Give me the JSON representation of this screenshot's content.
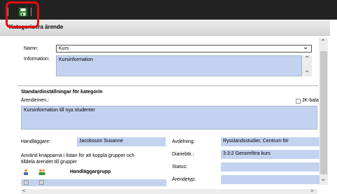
{
  "dialog": {
    "title": "Kategorisera ärende"
  },
  "form": {
    "namn_label": "Namn:",
    "namn_value": "Kurs",
    "information_label": "Information:",
    "information_value": "Kursinformation"
  },
  "standard": {
    "heading": "Standardinställningar för kategorin",
    "arendemening_label": "Ärendemen.:",
    "jk_label": "JK-bala",
    "arendemening_value": "Kursinformation till nya studenter"
  },
  "details": {
    "handlaggare_label": "Handläggare:",
    "handlaggare_value": "Jacobsson Susanne",
    "hint_line1": "Använd knapparna i listan för att koppla grupper och",
    "hint_line2": "tilldela ärendet till grupper",
    "group_column": "Handläggargrupp",
    "avdelning_label": "Avdelning:",
    "avdelning_value": "Rysslandsstudier, Centrum för",
    "diariebeteckning_label": "Diariebtk.:",
    "diariebeteckning_value": "3:3:2 Genomföra kurs",
    "status_label": "Status:",
    "status_value": "",
    "arendetyp_label": "Ärendetyp:",
    "arendetyp_value": ""
  },
  "icons": {
    "save": "floppy-disk-icon",
    "user": "user-icon",
    "group": "group-icon"
  },
  "colors": {
    "toolbar": "#222222",
    "highlight": "#e01010",
    "field_fill": "#c3d3ef"
  }
}
